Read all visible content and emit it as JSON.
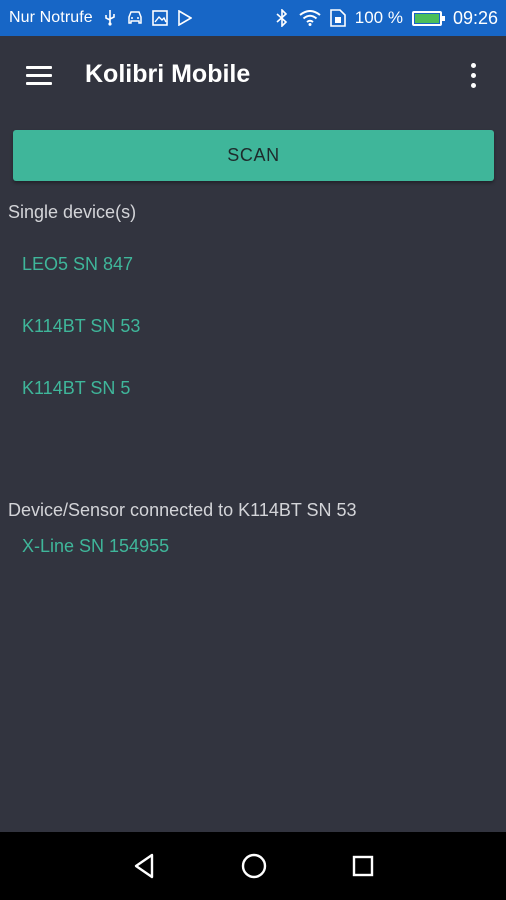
{
  "status_bar": {
    "carrier": "Nur Notrufe",
    "battery_percent": "100 %",
    "time": "09:26",
    "icons_left": [
      "usb-icon",
      "car-icon",
      "image-icon",
      "play-store-icon"
    ],
    "icons_right": [
      "bluetooth-icon",
      "wifi-icon",
      "sim-icon",
      "battery-charging-icon"
    ],
    "bg_color": "#1766c6"
  },
  "app_bar": {
    "title": "Kolibri Mobile",
    "menu_icon": "hamburger-menu-icon",
    "overflow_icon": "overflow-menu-icon"
  },
  "scan": {
    "label": "SCAN",
    "color": "#3fb69a"
  },
  "single_devices": {
    "header": "Single device(s)",
    "items": [
      {
        "label": "LEO5 SN 847"
      },
      {
        "label": "K114BT SN 53"
      },
      {
        "label": "K114BT SN 5"
      }
    ]
  },
  "connected": {
    "header": "Device/Sensor connected to K114BT SN 53",
    "items": [
      {
        "label": "X-Line SN 154955"
      }
    ]
  },
  "nav_bar": {
    "buttons": [
      "back-icon",
      "home-icon",
      "recents-icon"
    ]
  },
  "theme": {
    "background": "#32343f",
    "accent": "#3fb69a",
    "text_secondary": "#d3d4d8"
  }
}
